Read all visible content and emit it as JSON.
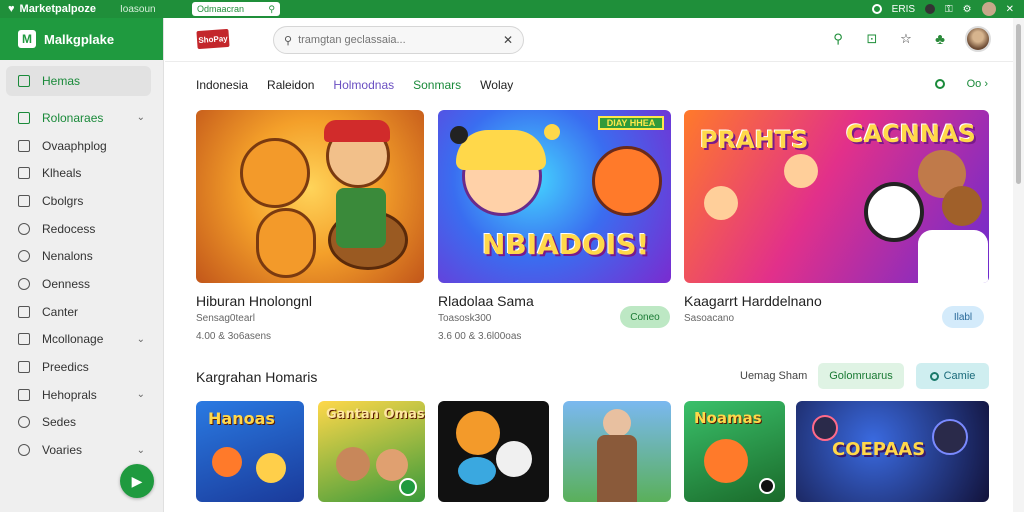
{
  "topbar": {
    "brand": "Marketpalpoze",
    "second_tab": "Ioasoun",
    "url_pill": "Odmaacran",
    "right_label": "ERIS"
  },
  "sidebar": {
    "title": "Malkgplake",
    "items": [
      {
        "label": "Hemas",
        "icon": "home-icon"
      },
      {
        "label": "Rolonaraes",
        "icon": "leaf-icon",
        "chevron": true
      },
      {
        "label": "Ovaaphplog",
        "icon": "list-icon"
      },
      {
        "label": "Klheals",
        "icon": "square-icon"
      },
      {
        "label": "Cbolgrs",
        "icon": "box-icon"
      },
      {
        "label": "Redocess",
        "icon": "target-icon"
      },
      {
        "label": "Nenalons",
        "icon": "settings-icon"
      },
      {
        "label": "Oenness",
        "icon": "search-icon"
      },
      {
        "label": "Canter",
        "icon": "doc-icon"
      },
      {
        "label": "Mcollonage",
        "icon": "grid-icon",
        "chevron": true
      },
      {
        "label": "Preedics",
        "icon": "page-icon"
      },
      {
        "label": "Hehoprals",
        "icon": "folder-icon",
        "chevron": true
      },
      {
        "label": "Sedes",
        "icon": "gear-icon"
      },
      {
        "label": "Voaries",
        "icon": "star-icon",
        "chevron": true
      }
    ]
  },
  "header": {
    "logo_text": "ShoPay",
    "search_placeholder": "tramgtan geclassaia..."
  },
  "tabs": [
    "Indonesia",
    "Raleidon",
    "Holmodnas",
    "Sonmars",
    "Wolay"
  ],
  "tabs_right_label": "Oo",
  "featured": [
    {
      "title": "Hiburan Hnolongnl",
      "sub": "Sensag0tearl",
      "meta": "4.00 & 3o6asens",
      "art_text": ""
    },
    {
      "title": "Rladolaa Sama",
      "sub": "Toasosk300",
      "meta": "3.6 00 & 3.6l00oas",
      "art_text": "NBIADOIS!",
      "banner": "DIAY HHEA",
      "button": "Coneo"
    },
    {
      "title": "Kaagarrt Harddelnano",
      "sub": "Sasoacano",
      "meta": "",
      "art_text": "PRAHTS",
      "art_text2": "CACNNAS",
      "button": "Ilabl"
    }
  ],
  "section2": {
    "title": "Kargrahan Homaris",
    "link": "Uemag Sham",
    "chip1": "Golomruarus",
    "chip2": "Camie"
  },
  "small_cards": [
    {
      "art_text": "Hanoas"
    },
    {
      "art_text": "Gantan Omas"
    },
    {
      "art_text": ""
    },
    {
      "art_text": ""
    },
    {
      "art_text": "Noamas"
    },
    {
      "art_text": "COEPAAS"
    }
  ],
  "colors": {
    "brand_green": "#1f9a3f",
    "sidebar_bg": "#efefef",
    "accent_purple": "#6a4fc2"
  }
}
